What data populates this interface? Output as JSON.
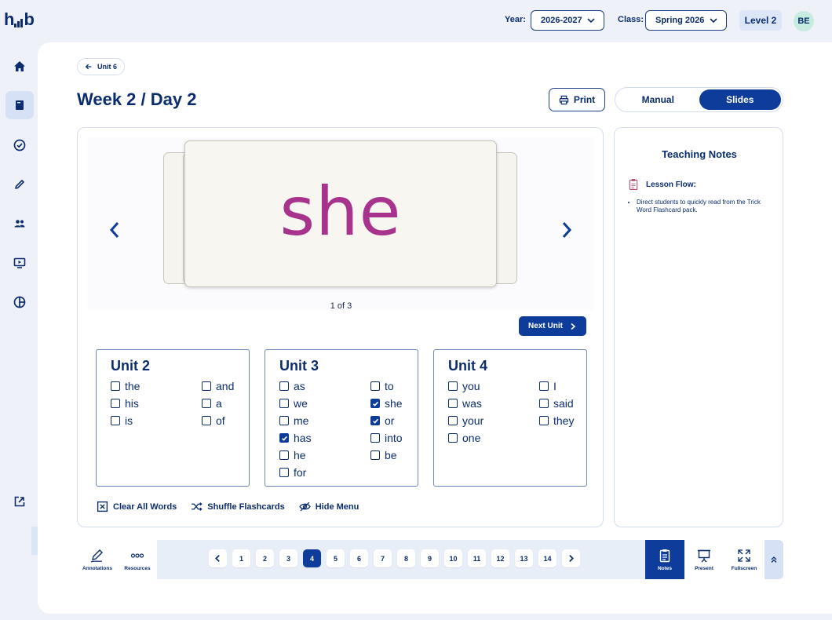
{
  "header": {
    "logo": "hub",
    "year_label": "Year:",
    "year_value": "2026-2027",
    "class_label": "Class:",
    "class_value": "Spring 2026",
    "level": "Level 2",
    "avatar": "BE"
  },
  "sidebar": {
    "items": [
      {
        "icon": "home-icon"
      },
      {
        "icon": "book-icon",
        "active": true
      },
      {
        "icon": "check-circle-icon"
      },
      {
        "icon": "pencil-icon"
      },
      {
        "icon": "people-icon"
      },
      {
        "icon": "presentation-icon"
      },
      {
        "icon": "pie-chart-icon"
      }
    ],
    "bottom_icon": "external-link-icon",
    "expand_icon": "chevron-right-icon"
  },
  "page": {
    "back_label": "Unit 6",
    "title": "Week 2 / Day 2",
    "print_label": "Print",
    "view_modes": [
      "Manual",
      "Slides"
    ],
    "active_view": "Slides"
  },
  "flashcard": {
    "word": "she",
    "counter": "1 of 3",
    "next_unit_label": "Next Unit"
  },
  "units": [
    {
      "title": "Unit 2",
      "words": [
        {
          "text": "the",
          "checked": false
        },
        {
          "text": "and",
          "checked": false
        },
        {
          "text": "his",
          "checked": false
        },
        {
          "text": "a",
          "checked": false
        },
        {
          "text": "is",
          "checked": false
        },
        {
          "text": "of",
          "checked": false
        }
      ]
    },
    {
      "title": "Unit 3",
      "words": [
        {
          "text": "as",
          "checked": false
        },
        {
          "text": "to",
          "checked": false
        },
        {
          "text": "we",
          "checked": false
        },
        {
          "text": "she",
          "checked": true
        },
        {
          "text": "me",
          "checked": false
        },
        {
          "text": "or",
          "checked": true
        },
        {
          "text": "has",
          "checked": true
        },
        {
          "text": "into",
          "checked": false
        },
        {
          "text": "he",
          "checked": false
        },
        {
          "text": "be",
          "checked": false
        },
        {
          "text": "for",
          "checked": false
        }
      ]
    },
    {
      "title": "Unit 4",
      "words": [
        {
          "text": "you",
          "checked": false
        },
        {
          "text": "I",
          "checked": false
        },
        {
          "text": "was",
          "checked": false
        },
        {
          "text": "said",
          "checked": false
        },
        {
          "text": "your",
          "checked": false
        },
        {
          "text": "they",
          "checked": false
        },
        {
          "text": "one",
          "checked": false
        }
      ]
    }
  ],
  "actions": {
    "clear": "Clear All Words",
    "shuffle": "Shuffle Flashcards",
    "hide": "Hide Menu"
  },
  "notes": {
    "title": "Teaching Notes",
    "subtitle": "Lesson Flow:",
    "items": [
      "Direct students to quickly read from the Trick Word Flashcard pack."
    ]
  },
  "toolbar": {
    "annotations": "Annotations",
    "resources": "Resources",
    "pages": [
      "1",
      "2",
      "3",
      "4",
      "5",
      "6",
      "7",
      "8",
      "9",
      "10",
      "11",
      "12",
      "13",
      "14"
    ],
    "current_page": "4",
    "notes": "Notes",
    "present": "Present",
    "fullscreen": "Fullscreen"
  },
  "colors": {
    "primary": "#0d3c9b",
    "text": "#0b2d6e",
    "word": "#a8338c",
    "card": "#f8f6f1"
  }
}
